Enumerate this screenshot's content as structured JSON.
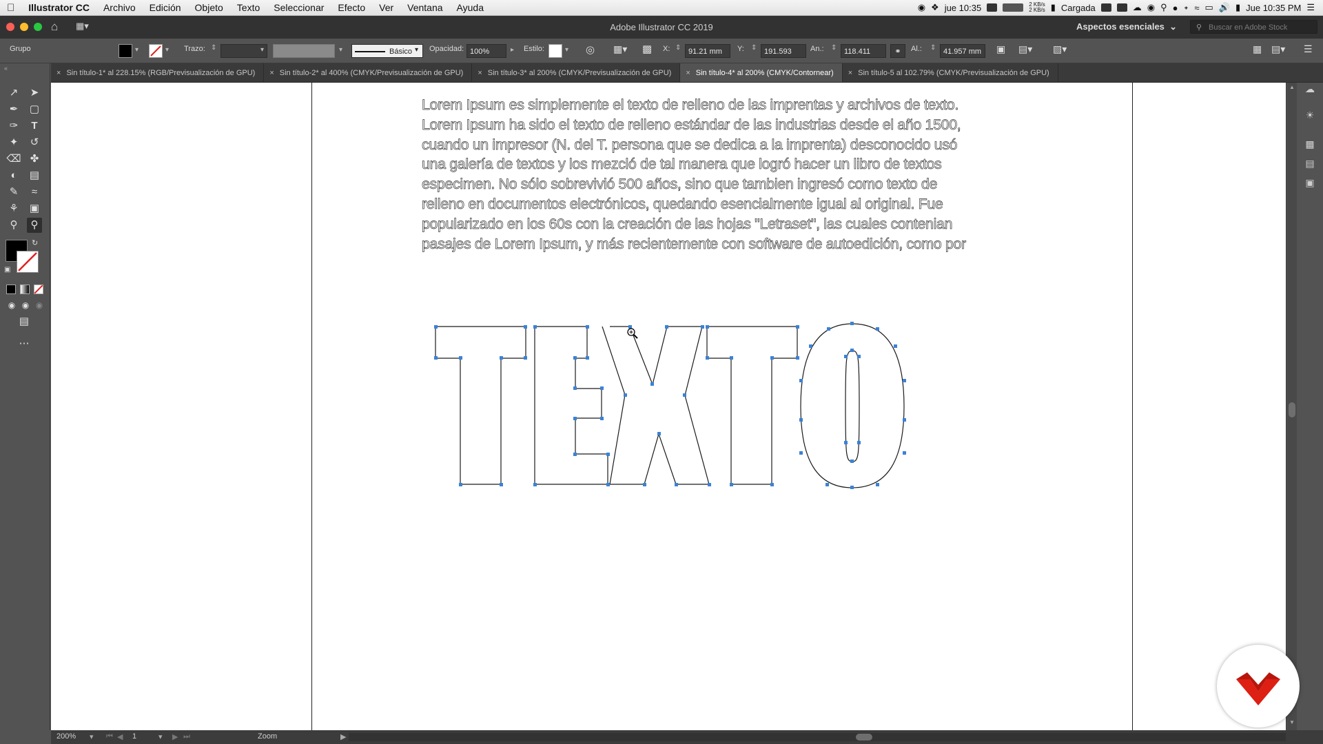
{
  "menubar": {
    "app_name": "Illustrator CC",
    "items": [
      "Archivo",
      "Edición",
      "Objeto",
      "Texto",
      "Seleccionar",
      "Efecto",
      "Ver",
      "Ventana",
      "Ayuda"
    ],
    "clock_left": "jue 10:35",
    "net_up": "2 KB/s",
    "net_down": "2 KB/s",
    "battery_text": "Cargada",
    "clock_right": "Jue 10:35 PM"
  },
  "titlebar": {
    "title": "Adobe Illustrator CC 2019",
    "workspace": "Aspectos esenciales",
    "stock_search_placeholder": "Buscar en Adobe Stock"
  },
  "controlbar": {
    "selection_label": "Grupo",
    "stroke_label": "Trazo:",
    "brush_label": "Básico",
    "opacity_label": "Opacidad:",
    "opacity_value": "100%",
    "style_label": "Estilo:",
    "x_label": "X:",
    "x_value": "91.21 mm",
    "y_label": "Y:",
    "y_value": "191.593 mm",
    "w_label": "An.:",
    "w_value": "118.411 mm",
    "h_label": "Al.:",
    "h_value": "41.957 mm"
  },
  "tabs": [
    {
      "label": "Sin título-1* al 228.15% (RGB/Previsualización de GPU)",
      "active": false
    },
    {
      "label": "Sin título-2* al 400% (CMYK/Previsualización de GPU)",
      "active": false
    },
    {
      "label": "Sin título-3* al 200% (CMYK/Previsualización de GPU)",
      "active": false
    },
    {
      "label": "Sin título-4* al 200% (CMYK/Contornear)",
      "active": true
    },
    {
      "label": "Sin título-5 al 102.79% (CMYK/Previsualización de GPU)",
      "active": false
    }
  ],
  "canvas": {
    "paragraph_lines": [
      "Lorem Ipsum es simplemente el texto de relleno de las imprentas y archivos de texto.",
      "Lorem Ipsum ha sido el texto de relleno estándar de las industrias desde el año 1500,",
      "cuando un impresor (N. del T. persona que se dedica a la imprenta) desconocido usó",
      "una galería de textos y los mezcló de tal manera que logró hacer un libro de textos",
      "especimen. No sólo sobrevivió 500 años, sino que tambien ingresó como texto de",
      "relleno en documentos electrónicos, quedando esencialmente igual al original. Fue",
      "popularizado en los 60s con la creación de las hojas \"Letraset\", las cuales contenian",
      "pasajes de Lorem Ipsum, y más recientemente con software de autoedición, como por"
    ],
    "outlined_word": "TEXTO",
    "outline_color": "#1a1a1a",
    "anchor_color": "#3b82d6"
  },
  "statusbar": {
    "zoom": "200%",
    "artboard": "1",
    "tool_name": "Zoom"
  },
  "colors": {
    "fill": "#000000",
    "logo_red": "#dd1f14"
  }
}
